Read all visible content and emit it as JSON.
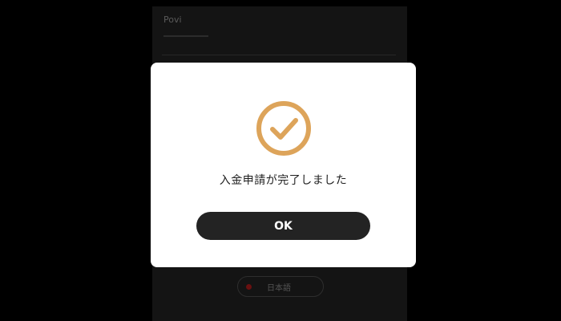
{
  "background": {
    "tab_label": "Povi",
    "language_label": "日本語"
  },
  "modal": {
    "icon": "check-circle-icon",
    "message": "入金申請が完了しました",
    "ok_label": "OK"
  },
  "colors": {
    "accent": "#DDA45A",
    "button": "#232323",
    "overlay": "#000000"
  }
}
